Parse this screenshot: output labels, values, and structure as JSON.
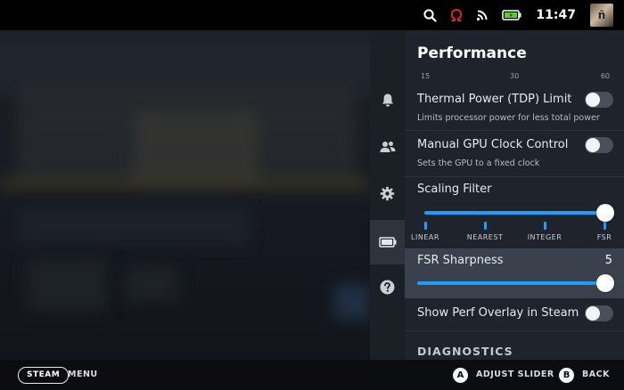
{
  "status_bar": {
    "time": "11:47",
    "icons": [
      "search-icon",
      "omega-icon",
      "wifi-icon",
      "battery-icon"
    ],
    "avatar_initial": "ñ"
  },
  "rail": {
    "items": [
      "bell-icon",
      "friends-icon",
      "gear-icon",
      "battery-icon",
      "help-icon"
    ],
    "active_index": 3
  },
  "panel": {
    "title": "Performance",
    "ticks": [
      "15",
      "30",
      "60"
    ],
    "tdp": {
      "label": "Thermal Power (TDP) Limit",
      "desc": "Limits processor power for less total power",
      "on": false
    },
    "gpu": {
      "label": "Manual GPU Clock Control",
      "desc": "Sets the GPU to a fixed clock",
      "on": false
    },
    "scaling": {
      "label": "Scaling Filter",
      "options": [
        "LINEAR",
        "NEAREST",
        "INTEGER",
        "FSR"
      ],
      "selected": "FSR"
    },
    "fsr": {
      "label": "FSR Sharpness",
      "value": "5",
      "fraction": 1.0
    },
    "perf_overlay": {
      "label": "Show Perf Overlay in Steam",
      "on": false
    },
    "diagnostics_title": "DIAGNOSTICS"
  },
  "bottom_bar": {
    "steam_label": "STEAM",
    "menu_label": "MENU",
    "a_glyph": "A",
    "a_label": "ADJUST SLIDER",
    "b_glyph": "B",
    "b_label": "BACK"
  },
  "colors": {
    "accent": "#1a9fff",
    "panel_bg": "#1f242c",
    "highlight": "#3a414c"
  }
}
